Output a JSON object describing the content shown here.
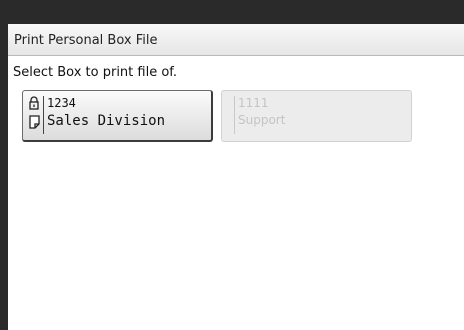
{
  "dialog": {
    "title": "Print Personal Box File",
    "prompt": "Select Box to print file of."
  },
  "boxes": [
    {
      "number": "1234",
      "name": "Sales Division",
      "enabled": true,
      "icons": [
        "lock-icon",
        "document-icon"
      ]
    },
    {
      "number": "1111",
      "name": "Support",
      "enabled": false
    }
  ]
}
